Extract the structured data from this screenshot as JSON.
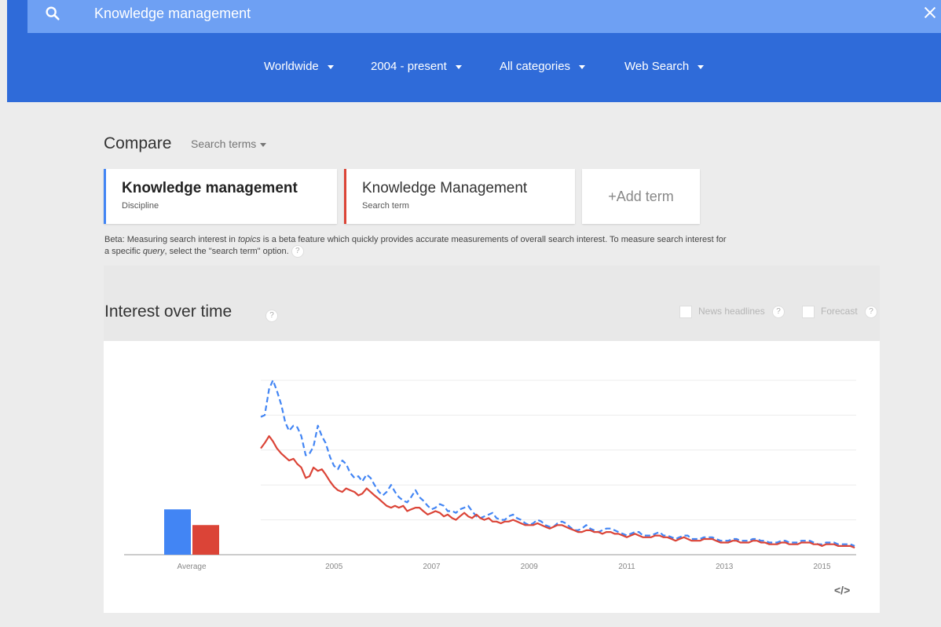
{
  "search": {
    "query": "Knowledge management"
  },
  "filters": [
    {
      "label": "Worldwide"
    },
    {
      "label": "2004 - present"
    },
    {
      "label": "All categories"
    },
    {
      "label": "Web Search"
    }
  ],
  "compare": {
    "title": "Compare",
    "mode": "Search terms",
    "terms": [
      {
        "title": "Knowledge management",
        "subtitle": "Discipline",
        "color": "#4285f4"
      },
      {
        "title": "Knowledge Management",
        "subtitle": "Search term",
        "color": "#db4437"
      }
    ],
    "add_label": "+Add term",
    "beta_note_1": "Beta: Measuring search interest in ",
    "beta_note_topics": "topics",
    "beta_note_2": " is a beta feature which quickly provides accurate measurements of overall search interest. To measure search interest for a specific ",
    "beta_note_query": "query",
    "beta_note_3": ", select the \"search term\" option.",
    "help_glyph": "?"
  },
  "interest": {
    "title": "Interest over time",
    "news_label": "News headlines",
    "forecast_label": "Forecast",
    "embed_glyph": "</>"
  },
  "chart_data": {
    "type": "line",
    "x_tick_labels": [
      "2005",
      "2007",
      "2009",
      "2011",
      "2013",
      "2015"
    ],
    "x_range": [
      2004.0,
      2016.2
    ],
    "y_range": [
      0,
      100
    ],
    "grid": true,
    "average": {
      "label": "Average",
      "values": [
        26,
        17
      ],
      "colors": [
        "#4285f4",
        "#db4437"
      ]
    },
    "series": [
      {
        "color": "#4285f4",
        "dashed": true,
        "points": [
          [
            2004.0,
            79
          ],
          [
            2004.08,
            80
          ],
          [
            2004.17,
            95
          ],
          [
            2004.25,
            100
          ],
          [
            2004.33,
            94
          ],
          [
            2004.42,
            86
          ],
          [
            2004.5,
            76
          ],
          [
            2004.58,
            71
          ],
          [
            2004.67,
            74
          ],
          [
            2004.75,
            73
          ],
          [
            2004.83,
            68
          ],
          [
            2004.92,
            57
          ],
          [
            2005.0,
            58
          ],
          [
            2005.08,
            62
          ],
          [
            2005.17,
            74
          ],
          [
            2005.25,
            68
          ],
          [
            2005.33,
            64
          ],
          [
            2005.42,
            56
          ],
          [
            2005.5,
            51
          ],
          [
            2005.58,
            49
          ],
          [
            2005.67,
            54
          ],
          [
            2005.75,
            52
          ],
          [
            2005.83,
            47
          ],
          [
            2005.92,
            44
          ],
          [
            2006.0,
            45
          ],
          [
            2006.08,
            42
          ],
          [
            2006.17,
            46
          ],
          [
            2006.25,
            44
          ],
          [
            2006.33,
            40
          ],
          [
            2006.42,
            36
          ],
          [
            2006.5,
            34
          ],
          [
            2006.58,
            36
          ],
          [
            2006.67,
            40
          ],
          [
            2006.75,
            36
          ],
          [
            2006.83,
            33
          ],
          [
            2006.92,
            31
          ],
          [
            2007.0,
            30
          ],
          [
            2007.08,
            33
          ],
          [
            2007.17,
            37
          ],
          [
            2007.25,
            33
          ],
          [
            2007.33,
            31
          ],
          [
            2007.42,
            28
          ],
          [
            2007.5,
            26
          ],
          [
            2007.58,
            27
          ],
          [
            2007.67,
            29
          ],
          [
            2007.75,
            28
          ],
          [
            2007.83,
            25
          ],
          [
            2007.92,
            25
          ],
          [
            2008.0,
            24
          ],
          [
            2008.08,
            26
          ],
          [
            2008.17,
            27
          ],
          [
            2008.25,
            28
          ],
          [
            2008.33,
            25
          ],
          [
            2008.42,
            22
          ],
          [
            2008.5,
            21
          ],
          [
            2008.58,
            22
          ],
          [
            2008.67,
            23
          ],
          [
            2008.75,
            24
          ],
          [
            2008.83,
            21
          ],
          [
            2008.92,
            20
          ],
          [
            2009.0,
            20
          ],
          [
            2009.08,
            22
          ],
          [
            2009.17,
            23
          ],
          [
            2009.25,
            21
          ],
          [
            2009.33,
            20
          ],
          [
            2009.42,
            18
          ],
          [
            2009.5,
            17
          ],
          [
            2009.58,
            18
          ],
          [
            2009.67,
            20
          ],
          [
            2009.75,
            19
          ],
          [
            2009.83,
            17
          ],
          [
            2009.92,
            16
          ],
          [
            2010.0,
            16
          ],
          [
            2010.08,
            18
          ],
          [
            2010.17,
            19
          ],
          [
            2010.25,
            18
          ],
          [
            2010.33,
            16
          ],
          [
            2010.42,
            14
          ],
          [
            2010.5,
            14
          ],
          [
            2010.58,
            15
          ],
          [
            2010.67,
            17
          ],
          [
            2010.75,
            15
          ],
          [
            2010.83,
            14
          ],
          [
            2010.92,
            13
          ],
          [
            2011.0,
            14
          ],
          [
            2011.08,
            15
          ],
          [
            2011.17,
            15
          ],
          [
            2011.25,
            14
          ],
          [
            2011.33,
            13
          ],
          [
            2011.42,
            12
          ],
          [
            2011.5,
            11
          ],
          [
            2011.58,
            12
          ],
          [
            2011.67,
            13
          ],
          [
            2011.75,
            13
          ],
          [
            2011.83,
            11
          ],
          [
            2011.92,
            11
          ],
          [
            2012.0,
            11
          ],
          [
            2012.08,
            12
          ],
          [
            2012.17,
            13
          ],
          [
            2012.25,
            11
          ],
          [
            2012.33,
            11
          ],
          [
            2012.42,
            10
          ],
          [
            2012.5,
            9
          ],
          [
            2012.58,
            10
          ],
          [
            2012.67,
            11
          ],
          [
            2012.75,
            11
          ],
          [
            2012.83,
            9
          ],
          [
            2012.92,
            9
          ],
          [
            2013.0,
            9
          ],
          [
            2013.08,
            10
          ],
          [
            2013.17,
            10
          ],
          [
            2013.25,
            10
          ],
          [
            2013.33,
            9
          ],
          [
            2013.42,
            8
          ],
          [
            2013.5,
            8
          ],
          [
            2013.58,
            8
          ],
          [
            2013.67,
            9
          ],
          [
            2013.75,
            9
          ],
          [
            2013.83,
            8
          ],
          [
            2013.92,
            8
          ],
          [
            2014.0,
            8
          ],
          [
            2014.08,
            9
          ],
          [
            2014.17,
            9
          ],
          [
            2014.25,
            8
          ],
          [
            2014.33,
            8
          ],
          [
            2014.42,
            7
          ],
          [
            2014.5,
            7
          ],
          [
            2014.58,
            7
          ],
          [
            2014.67,
            8
          ],
          [
            2014.75,
            8
          ],
          [
            2014.83,
            7
          ],
          [
            2014.92,
            7
          ],
          [
            2015.0,
            7
          ],
          [
            2015.08,
            8
          ],
          [
            2015.17,
            8
          ],
          [
            2015.25,
            8
          ],
          [
            2015.33,
            7
          ],
          [
            2015.42,
            6
          ],
          [
            2015.5,
            6
          ],
          [
            2015.58,
            7
          ],
          [
            2015.67,
            7
          ],
          [
            2015.75,
            7
          ],
          [
            2015.83,
            6
          ],
          [
            2015.92,
            6
          ],
          [
            2016.0,
            6
          ],
          [
            2016.08,
            6
          ],
          [
            2016.17,
            5
          ]
        ]
      },
      {
        "color": "#db4437",
        "dashed": false,
        "points": [
          [
            2004.0,
            61
          ],
          [
            2004.08,
            64
          ],
          [
            2004.17,
            68
          ],
          [
            2004.25,
            65
          ],
          [
            2004.33,
            61
          ],
          [
            2004.42,
            58
          ],
          [
            2004.5,
            56
          ],
          [
            2004.58,
            54
          ],
          [
            2004.67,
            55
          ],
          [
            2004.75,
            52
          ],
          [
            2004.83,
            50
          ],
          [
            2004.92,
            44
          ],
          [
            2005.0,
            45
          ],
          [
            2005.08,
            50
          ],
          [
            2005.17,
            48
          ],
          [
            2005.25,
            49
          ],
          [
            2005.33,
            46
          ],
          [
            2005.42,
            42
          ],
          [
            2005.5,
            39
          ],
          [
            2005.58,
            37
          ],
          [
            2005.67,
            36
          ],
          [
            2005.75,
            38
          ],
          [
            2005.83,
            37
          ],
          [
            2005.92,
            36
          ],
          [
            2006.0,
            34
          ],
          [
            2006.08,
            35
          ],
          [
            2006.17,
            38
          ],
          [
            2006.25,
            36
          ],
          [
            2006.33,
            34
          ],
          [
            2006.42,
            32
          ],
          [
            2006.5,
            30
          ],
          [
            2006.58,
            28
          ],
          [
            2006.67,
            27
          ],
          [
            2006.75,
            28
          ],
          [
            2006.83,
            27
          ],
          [
            2006.92,
            28
          ],
          [
            2007.0,
            25
          ],
          [
            2007.08,
            26
          ],
          [
            2007.17,
            27
          ],
          [
            2007.25,
            27
          ],
          [
            2007.33,
            25
          ],
          [
            2007.42,
            23
          ],
          [
            2007.5,
            24
          ],
          [
            2007.58,
            25
          ],
          [
            2007.67,
            24
          ],
          [
            2007.75,
            22
          ],
          [
            2007.83,
            23
          ],
          [
            2007.92,
            21
          ],
          [
            2008.0,
            20
          ],
          [
            2008.08,
            22
          ],
          [
            2008.17,
            24
          ],
          [
            2008.25,
            22
          ],
          [
            2008.33,
            21
          ],
          [
            2008.42,
            23
          ],
          [
            2008.5,
            21
          ],
          [
            2008.58,
            20
          ],
          [
            2008.67,
            21
          ],
          [
            2008.75,
            19
          ],
          [
            2008.83,
            19
          ],
          [
            2008.92,
            18
          ],
          [
            2009.0,
            19
          ],
          [
            2009.08,
            19
          ],
          [
            2009.17,
            20
          ],
          [
            2009.25,
            19
          ],
          [
            2009.33,
            18
          ],
          [
            2009.42,
            17
          ],
          [
            2009.5,
            17
          ],
          [
            2009.58,
            17
          ],
          [
            2009.67,
            18
          ],
          [
            2009.75,
            17
          ],
          [
            2009.83,
            16
          ],
          [
            2009.92,
            15
          ],
          [
            2010.0,
            16
          ],
          [
            2010.08,
            17
          ],
          [
            2010.17,
            17
          ],
          [
            2010.25,
            16
          ],
          [
            2010.33,
            15
          ],
          [
            2010.42,
            14
          ],
          [
            2010.5,
            13
          ],
          [
            2010.58,
            13
          ],
          [
            2010.67,
            14
          ],
          [
            2010.75,
            14
          ],
          [
            2010.83,
            13
          ],
          [
            2010.92,
            13
          ],
          [
            2011.0,
            12
          ],
          [
            2011.08,
            13
          ],
          [
            2011.17,
            13
          ],
          [
            2011.25,
            12
          ],
          [
            2011.33,
            12
          ],
          [
            2011.42,
            11
          ],
          [
            2011.5,
            10
          ],
          [
            2011.58,
            11
          ],
          [
            2011.67,
            12
          ],
          [
            2011.75,
            11
          ],
          [
            2011.83,
            10
          ],
          [
            2011.92,
            10
          ],
          [
            2012.0,
            10
          ],
          [
            2012.08,
            11
          ],
          [
            2012.17,
            11
          ],
          [
            2012.25,
            10
          ],
          [
            2012.33,
            10
          ],
          [
            2012.42,
            9
          ],
          [
            2012.5,
            8
          ],
          [
            2012.58,
            9
          ],
          [
            2012.67,
            10
          ],
          [
            2012.75,
            9
          ],
          [
            2012.83,
            8
          ],
          [
            2012.92,
            8
          ],
          [
            2013.0,
            8
          ],
          [
            2013.08,
            9
          ],
          [
            2013.17,
            9
          ],
          [
            2013.25,
            9
          ],
          [
            2013.33,
            8
          ],
          [
            2013.42,
            7
          ],
          [
            2013.5,
            7
          ],
          [
            2013.58,
            7
          ],
          [
            2013.67,
            8
          ],
          [
            2013.75,
            8
          ],
          [
            2013.83,
            7
          ],
          [
            2013.92,
            7
          ],
          [
            2014.0,
            7
          ],
          [
            2014.08,
            8
          ],
          [
            2014.17,
            8
          ],
          [
            2014.25,
            7
          ],
          [
            2014.33,
            7
          ],
          [
            2014.42,
            6
          ],
          [
            2014.5,
            6
          ],
          [
            2014.58,
            6
          ],
          [
            2014.67,
            7
          ],
          [
            2014.75,
            7
          ],
          [
            2014.83,
            6
          ],
          [
            2014.92,
            6
          ],
          [
            2015.0,
            6
          ],
          [
            2015.08,
            7
          ],
          [
            2015.17,
            7
          ],
          [
            2015.25,
            7
          ],
          [
            2015.33,
            6
          ],
          [
            2015.42,
            6
          ],
          [
            2015.5,
            5
          ],
          [
            2015.58,
            6
          ],
          [
            2015.67,
            6
          ],
          [
            2015.75,
            6
          ],
          [
            2015.83,
            5
          ],
          [
            2015.92,
            5
          ],
          [
            2016.0,
            5
          ],
          [
            2016.08,
            5
          ],
          [
            2016.17,
            4
          ]
        ]
      }
    ]
  }
}
